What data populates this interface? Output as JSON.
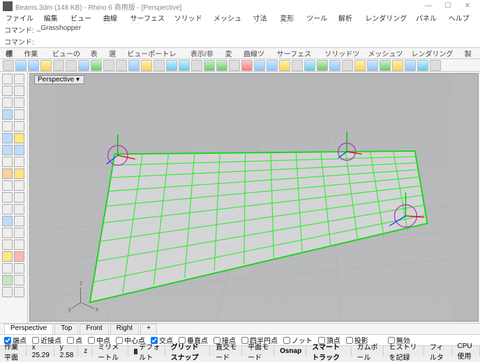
{
  "title": "Beams.3dm (148 KB) - Rhino 6 商用版 - [Perspective]",
  "menu": [
    "ファイル(F)",
    "編集(E)",
    "ビュー(V)",
    "曲線(C)",
    "サーフェス(S)",
    "ソリッド(O)",
    "メッシュ(M)",
    "寸法(D)",
    "変形(T)",
    "ツール(L)",
    "解析(A)",
    "レンダリング(R)",
    "パネル(P)",
    "ヘルプ(H)"
  ],
  "cmd1_label": "コマンド:",
  "cmd1_val": "_Grasshopper",
  "cmd2_label": "コマンド:",
  "tabs": [
    "標準",
    "作業平面",
    "ビューの設定",
    "表示",
    "選択",
    "ビューポートレイアウト",
    "表示/非表示",
    "変形",
    "曲線ツール",
    "サーフェスツール",
    "ソリッドツール",
    "メッシュツール",
    "レンダリングツール",
    "製図"
  ],
  "vp_name": "Perspective",
  "vptabs": [
    "Perspective",
    "Top",
    "Front",
    "Right"
  ],
  "osnap": {
    "items": [
      {
        "label": "端点",
        "checked": true
      },
      {
        "label": "近接点",
        "checked": false
      },
      {
        "label": "点",
        "checked": false
      },
      {
        "label": "中点",
        "checked": false
      },
      {
        "label": "中心点",
        "checked": false
      },
      {
        "label": "交点",
        "checked": true
      },
      {
        "label": "垂直点",
        "checked": false
      },
      {
        "label": "接点",
        "checked": false
      },
      {
        "label": "四半円点",
        "checked": false
      },
      {
        "label": "ノット",
        "checked": false
      },
      {
        "label": "頂点",
        "checked": false
      },
      {
        "label": "投影",
        "checked": false
      }
    ],
    "disable": "無効"
  },
  "status": {
    "plane": "作業平面",
    "x": "x 25.29",
    "y": "y 2.58",
    "z": "z",
    "unit": "ミリメートル",
    "layer": "デフォルト",
    "items": [
      "グリッドスナップ",
      "直交モード",
      "平面モード",
      "Osnap",
      "スマートトラック",
      "ガムボール",
      "ヒストリを記録",
      "フィルタ",
      "CPU使用"
    ]
  }
}
